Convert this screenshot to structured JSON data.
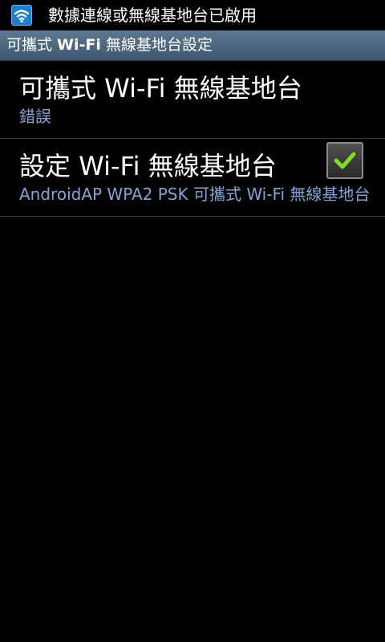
{
  "status_bar": {
    "icon": "wifi-hotspot-icon",
    "notification": "數據連線或無線基地台已啟用"
  },
  "title_bar": {
    "title_prefix": "可攜式 ",
    "title_bold": "Wi-Fi",
    "title_suffix": " 無線基地台設定"
  },
  "preferences": [
    {
      "title": "可攜式 Wi-Fi 無線基地台",
      "summary": "錯誤",
      "checked": true
    },
    {
      "title": "設定 Wi-Fi 無線基地台",
      "summary": "AndroidAP WPA2 PSK 可攜式 Wi-Fi 無線基地台"
    }
  ],
  "colors": {
    "summary_text": "#7fa7d6",
    "check_mark": "#7fdc1e",
    "status_icon_bg": "#1a7fd1"
  }
}
